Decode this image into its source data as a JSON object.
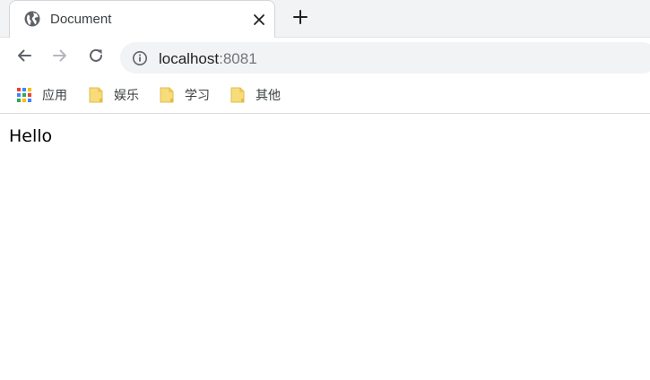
{
  "browser": {
    "tab": {
      "title": "Document",
      "favicon": "globe-icon",
      "close_icon": "close-icon"
    },
    "new_tab_icon": "plus-icon",
    "toolbar": {
      "back_icon": "back-arrow-icon",
      "forward_icon": "forward-arrow-icon",
      "reload_icon": "reload-icon",
      "site_info_icon": "info-icon",
      "url_host": "localhost",
      "url_port": ":8081"
    },
    "bookmarks": [
      {
        "label": "应用",
        "icon": "apps-grid-icon"
      },
      {
        "label": "娱乐",
        "icon": "folder-icon"
      },
      {
        "label": "学习",
        "icon": "folder-icon"
      },
      {
        "label": "其他",
        "icon": "folder-icon"
      }
    ]
  },
  "page": {
    "text": "Hello"
  },
  "colors": {
    "tabstrip_bg": "#f1f3f4",
    "omnibox_bg": "#f1f3f4",
    "folder_yellow": "#f5d569"
  }
}
